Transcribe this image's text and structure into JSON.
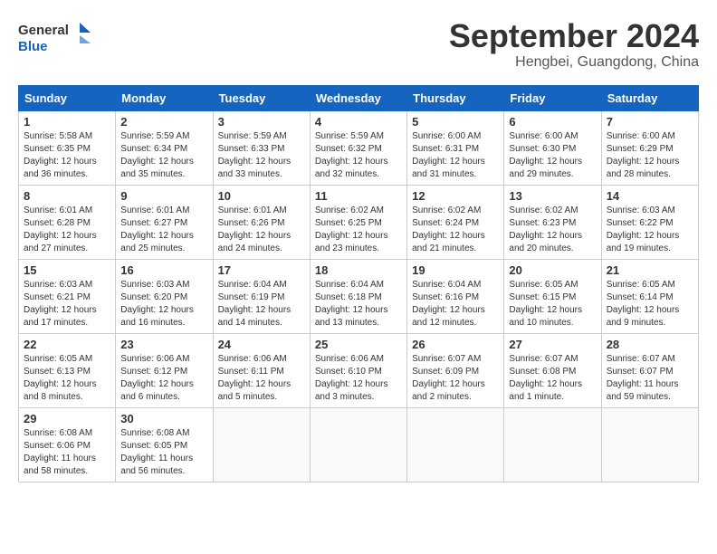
{
  "header": {
    "logo_text_general": "General",
    "logo_text_blue": "Blue",
    "month_title": "September 2024",
    "location": "Hengbei, Guangdong, China"
  },
  "calendar": {
    "days_of_week": [
      "Sunday",
      "Monday",
      "Tuesday",
      "Wednesday",
      "Thursday",
      "Friday",
      "Saturday"
    ],
    "weeks": [
      [
        null,
        null,
        null,
        null,
        null,
        null,
        null
      ]
    ]
  },
  "cells": {
    "w1": [
      {
        "day": "",
        "empty": true
      },
      {
        "day": "",
        "empty": true
      },
      {
        "day": "",
        "empty": true
      },
      {
        "day": "",
        "empty": true
      },
      {
        "day": "",
        "empty": true
      },
      {
        "day": "",
        "empty": true
      },
      {
        "day": "",
        "empty": true
      }
    ],
    "week1": [
      {
        "num": "1",
        "sun": true,
        "rise": "5:58 AM",
        "set": "6:35 PM",
        "daylight": "12 hours and 36 minutes."
      },
      {
        "num": "2",
        "rise": "5:59 AM",
        "set": "6:34 PM",
        "daylight": "12 hours and 35 minutes."
      },
      {
        "num": "3",
        "rise": "5:59 AM",
        "set": "6:33 PM",
        "daylight": "12 hours and 33 minutes."
      },
      {
        "num": "4",
        "rise": "5:59 AM",
        "set": "6:32 PM",
        "daylight": "12 hours and 32 minutes."
      },
      {
        "num": "5",
        "rise": "6:00 AM",
        "set": "6:31 PM",
        "daylight": "12 hours and 31 minutes."
      },
      {
        "num": "6",
        "rise": "6:00 AM",
        "set": "6:30 PM",
        "daylight": "12 hours and 29 minutes."
      },
      {
        "num": "7",
        "rise": "6:00 AM",
        "set": "6:29 PM",
        "daylight": "12 hours and 28 minutes."
      }
    ],
    "week2": [
      {
        "num": "8",
        "rise": "6:01 AM",
        "set": "6:28 PM",
        "daylight": "12 hours and 27 minutes."
      },
      {
        "num": "9",
        "rise": "6:01 AM",
        "set": "6:27 PM",
        "daylight": "12 hours and 25 minutes."
      },
      {
        "num": "10",
        "rise": "6:01 AM",
        "set": "6:26 PM",
        "daylight": "12 hours and 24 minutes."
      },
      {
        "num": "11",
        "rise": "6:02 AM",
        "set": "6:25 PM",
        "daylight": "12 hours and 23 minutes."
      },
      {
        "num": "12",
        "rise": "6:02 AM",
        "set": "6:24 PM",
        "daylight": "12 hours and 21 minutes."
      },
      {
        "num": "13",
        "rise": "6:02 AM",
        "set": "6:23 PM",
        "daylight": "12 hours and 20 minutes."
      },
      {
        "num": "14",
        "rise": "6:03 AM",
        "set": "6:22 PM",
        "daylight": "12 hours and 19 minutes."
      }
    ],
    "week3": [
      {
        "num": "15",
        "rise": "6:03 AM",
        "set": "6:21 PM",
        "daylight": "12 hours and 17 minutes."
      },
      {
        "num": "16",
        "rise": "6:03 AM",
        "set": "6:20 PM",
        "daylight": "12 hours and 16 minutes."
      },
      {
        "num": "17",
        "rise": "6:04 AM",
        "set": "6:19 PM",
        "daylight": "12 hours and 14 minutes."
      },
      {
        "num": "18",
        "rise": "6:04 AM",
        "set": "6:18 PM",
        "daylight": "12 hours and 13 minutes."
      },
      {
        "num": "19",
        "rise": "6:04 AM",
        "set": "6:16 PM",
        "daylight": "12 hours and 12 minutes."
      },
      {
        "num": "20",
        "rise": "6:05 AM",
        "set": "6:15 PM",
        "daylight": "12 hours and 10 minutes."
      },
      {
        "num": "21",
        "rise": "6:05 AM",
        "set": "6:14 PM",
        "daylight": "12 hours and 9 minutes."
      }
    ],
    "week4": [
      {
        "num": "22",
        "rise": "6:05 AM",
        "set": "6:13 PM",
        "daylight": "12 hours and 8 minutes."
      },
      {
        "num": "23",
        "rise": "6:06 AM",
        "set": "6:12 PM",
        "daylight": "12 hours and 6 minutes."
      },
      {
        "num": "24",
        "rise": "6:06 AM",
        "set": "6:11 PM",
        "daylight": "12 hours and 5 minutes."
      },
      {
        "num": "25",
        "rise": "6:06 AM",
        "set": "6:10 PM",
        "daylight": "12 hours and 3 minutes."
      },
      {
        "num": "26",
        "rise": "6:07 AM",
        "set": "6:09 PM",
        "daylight": "12 hours and 2 minutes."
      },
      {
        "num": "27",
        "rise": "6:07 AM",
        "set": "6:08 PM",
        "daylight": "12 hours and 1 minute."
      },
      {
        "num": "28",
        "rise": "6:07 AM",
        "set": "6:07 PM",
        "daylight": "11 hours and 59 minutes."
      }
    ],
    "week5": [
      {
        "num": "29",
        "rise": "6:08 AM",
        "set": "6:06 PM",
        "daylight": "11 hours and 58 minutes."
      },
      {
        "num": "30",
        "rise": "6:08 AM",
        "set": "6:05 PM",
        "daylight": "11 hours and 56 minutes."
      },
      null,
      null,
      null,
      null,
      null
    ]
  },
  "labels": {
    "sunrise": "Sunrise:",
    "sunset": "Sunset:",
    "daylight": "Daylight:"
  }
}
